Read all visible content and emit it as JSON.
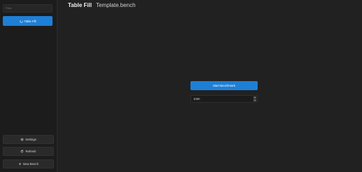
{
  "sidebar": {
    "filter_placeholder": "Filter",
    "bench_item": {
      "label": "Table Fill"
    },
    "settings_label": "Settings",
    "refresh_label": "Refresh",
    "new_bench_label": "New Bench"
  },
  "main": {
    "title": "Table Fill",
    "file": "Template.bench",
    "start_label": "Start Benchmark",
    "count_value": "1000"
  },
  "colors": {
    "accent": "#1e7fd6",
    "background": "#212121",
    "sidebar": "#1c1c1c"
  }
}
